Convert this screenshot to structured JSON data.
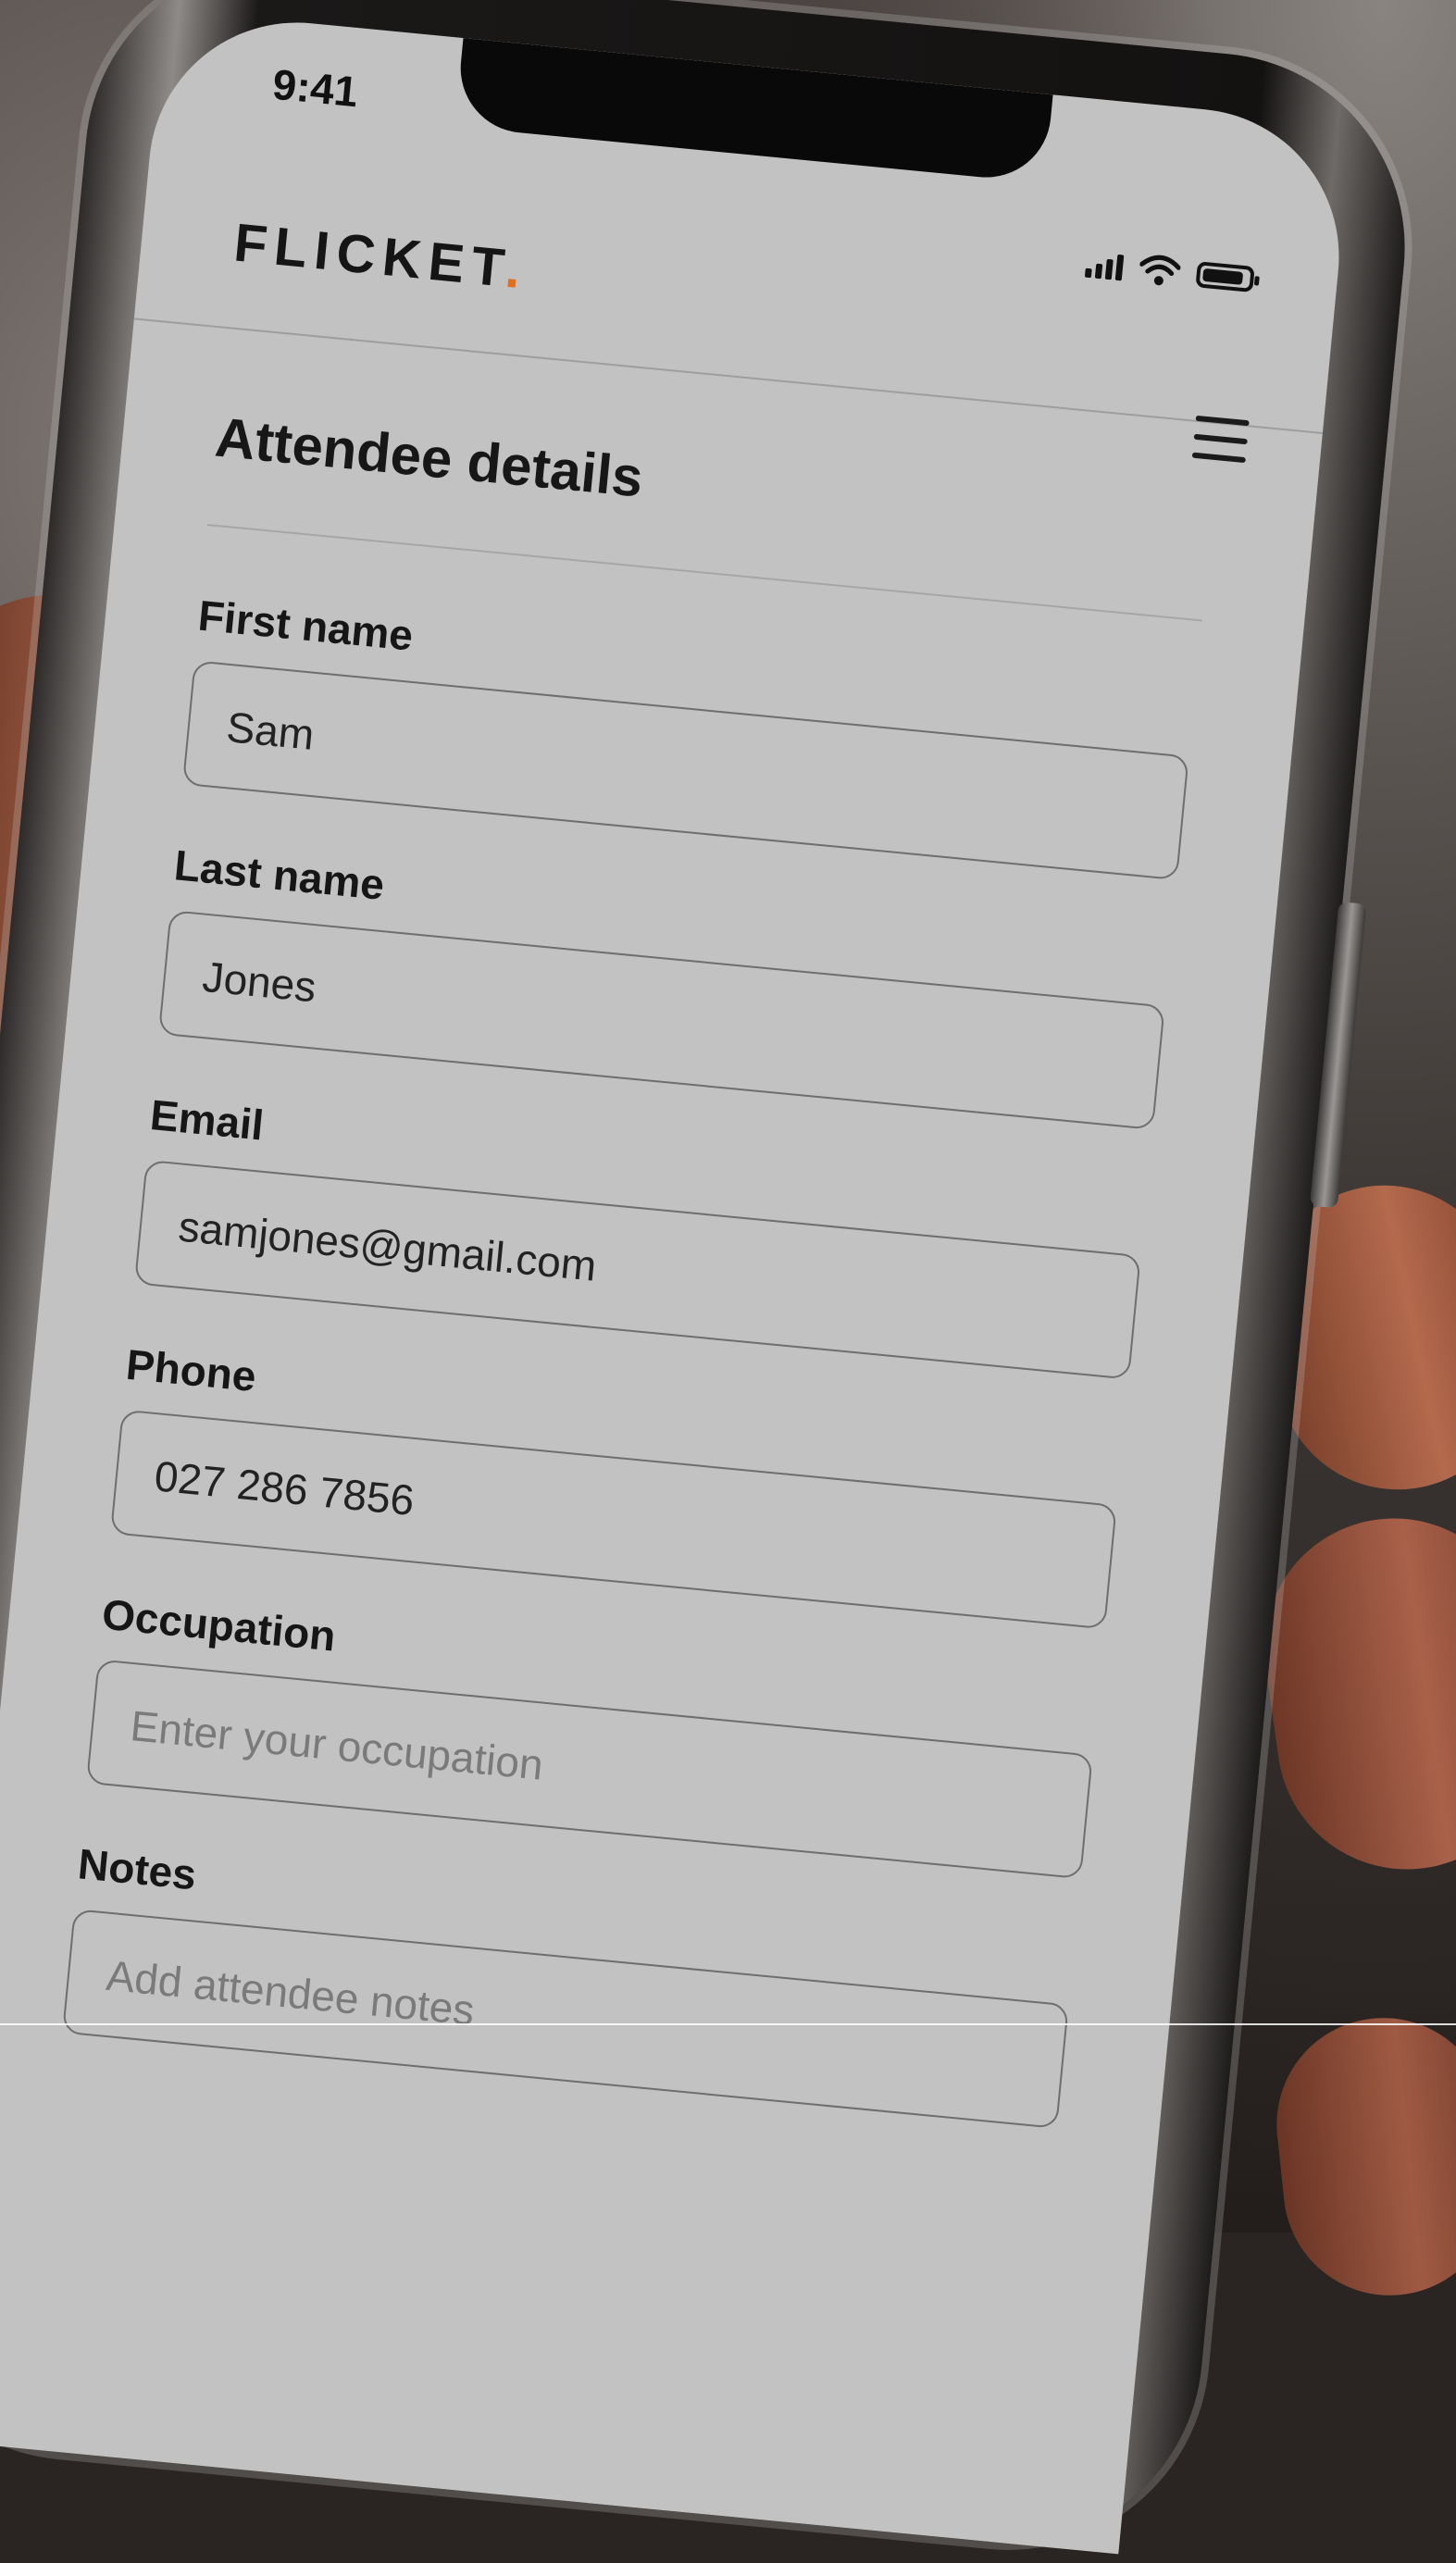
{
  "status_bar": {
    "time": "9:41"
  },
  "header": {
    "brand": "FLICKET",
    "brand_dot": ".",
    "brand_dot_color": "#e0701e"
  },
  "page": {
    "title": "Attendee details"
  },
  "form": {
    "first_name": {
      "label": "First name",
      "value": "Sam",
      "placeholder": ""
    },
    "last_name": {
      "label": "Last name",
      "value": "Jones",
      "placeholder": ""
    },
    "email": {
      "label": "Email",
      "value": "samjones@gmail.com",
      "placeholder": ""
    },
    "phone": {
      "label": "Phone",
      "value": "027 286 7856",
      "placeholder": ""
    },
    "occupation": {
      "label": "Occupation",
      "value": "",
      "placeholder": "Enter your occupation"
    },
    "notes": {
      "label": "Notes",
      "value": "",
      "placeholder": "Add attendee notes"
    }
  },
  "icons": {
    "menu": "hamburger-menu-icon",
    "signal": "cellular-signal-icon",
    "wifi": "wifi-icon",
    "battery": "battery-icon"
  }
}
